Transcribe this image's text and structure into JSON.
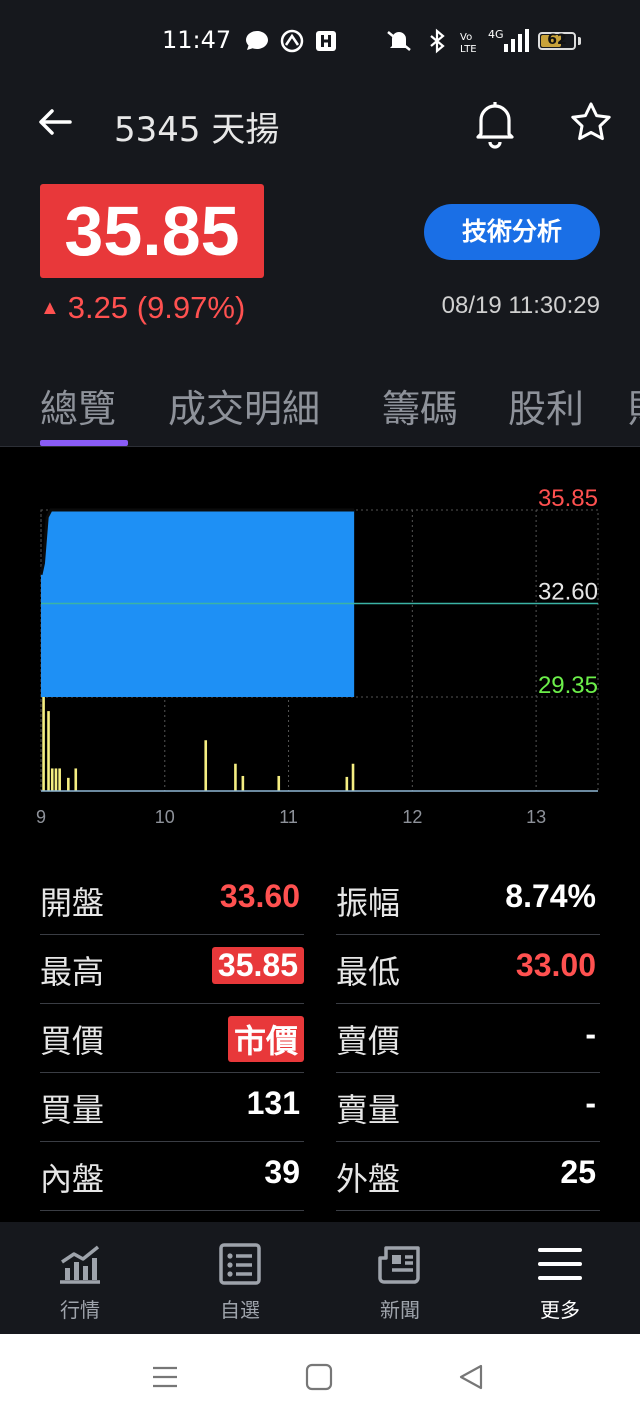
{
  "status_bar": {
    "time": "11:47",
    "battery": "62",
    "battery_level_pct": 62,
    "icons": [
      "chat-bubble-icon",
      "sync-app-icon",
      "h-app-icon",
      "mute-icon",
      "bluetooth-icon",
      "volte-icon",
      "signal-4g-icon",
      "battery-icon"
    ],
    "volte_label": "Vo LTE",
    "network_label": "4G"
  },
  "header": {
    "title": "5345 天揚",
    "icons": [
      "back-arrow-icon",
      "bell-icon",
      "star-icon"
    ]
  },
  "quote": {
    "price": "35.85",
    "change": "3.25 (9.97%)",
    "change_arrow": "▲",
    "timestamp": "08/19 11:30:29",
    "tech_button": "技術分析",
    "colors": {
      "up": "#ff5150",
      "price_bg": "#e8383a",
      "button": "#1a6fe6"
    }
  },
  "tabs": [
    {
      "label": "總覽",
      "active": true
    },
    {
      "label": "成交明細",
      "active": false
    },
    {
      "label": "籌碼",
      "active": false
    },
    {
      "label": "股利",
      "active": false
    },
    {
      "label": "財",
      "active": false
    }
  ],
  "chart_data": {
    "type": "area",
    "y_labels": {
      "high": "35.85",
      "ref": "32.60",
      "low": "29.35"
    },
    "ylim": [
      29.35,
      35.85
    ],
    "reference": 32.6,
    "xlim": [
      9,
      13.5
    ],
    "x_ticks": [
      "9",
      "10",
      "11",
      "12",
      "13"
    ],
    "price_series": {
      "x": [
        9.0,
        9.02,
        9.05,
        9.08,
        9.12,
        11.52,
        11.53
      ],
      "y": [
        33.6,
        34.0,
        35.6,
        35.85,
        35.85,
        35.85,
        35.85
      ]
    },
    "volume": {
      "x": [
        9.02,
        9.06,
        9.09,
        9.12,
        9.15,
        9.22,
        9.28,
        10.33,
        10.57,
        10.63,
        10.92,
        11.47,
        11.52
      ],
      "y": [
        100,
        85,
        24,
        24,
        24,
        14,
        24,
        54,
        29,
        16,
        16,
        15,
        29
      ],
      "ylim": [
        0,
        100
      ]
    },
    "colors": {
      "area": "#1e90f5",
      "volume": "#f5ee82",
      "high": "#ff5150",
      "ref": "#e6e6e6",
      "low": "#6cef4a",
      "ref_line": "#3bb3a5"
    }
  },
  "stats": {
    "left": [
      {
        "label": "開盤",
        "value": "33.60",
        "style": "red"
      },
      {
        "label": "最高",
        "value": "35.85",
        "style": "badge"
      },
      {
        "label": "買價",
        "value": "市價",
        "style": "badge"
      },
      {
        "label": "買量",
        "value": "131",
        "style": "white"
      },
      {
        "label": "內盤",
        "value": "39",
        "style": "white"
      }
    ],
    "right": [
      {
        "label": "振幅",
        "value": "8.74%",
        "style": "white"
      },
      {
        "label": "最低",
        "value": "33.00",
        "style": "red"
      },
      {
        "label": "賣價",
        "value": "-",
        "style": "white"
      },
      {
        "label": "賣量",
        "value": "-",
        "style": "white"
      },
      {
        "label": "外盤",
        "value": "25",
        "style": "white"
      }
    ]
  },
  "bottom_nav": [
    {
      "label": "行情",
      "icon": "market-chart-icon",
      "active": false
    },
    {
      "label": "自選",
      "icon": "watchlist-icon",
      "active": false
    },
    {
      "label": "新聞",
      "icon": "news-icon",
      "active": false
    },
    {
      "label": "更多",
      "icon": "menu-icon",
      "active": true
    }
  ],
  "system_nav": [
    "recents-icon",
    "home-icon",
    "back-icon"
  ]
}
